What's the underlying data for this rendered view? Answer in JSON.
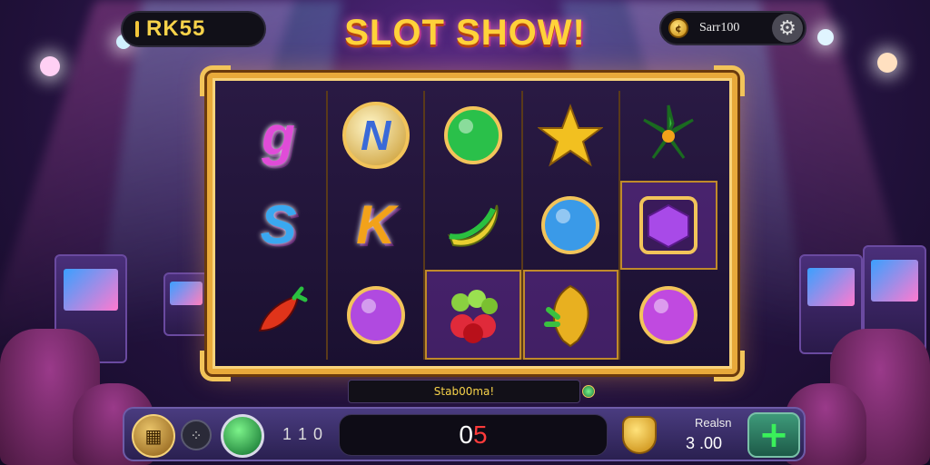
{
  "header": {
    "balance": "RK55",
    "title": "SLOT SHOW!",
    "settings_label": "Sarr100",
    "coin_icon": "coin-icon",
    "gear_icon": "gear-icon"
  },
  "reels": [
    [
      {
        "label": "g",
        "kind": "letter",
        "color": "#e04cd8",
        "icon": "letter-g-icon"
      },
      {
        "label": "S",
        "kind": "letter",
        "color": "#3aa8f0",
        "icon": "letter-s-icon"
      },
      {
        "label": "",
        "kind": "chili",
        "color": "#e0341a",
        "icon": "chili-pepper-icon"
      }
    ],
    [
      {
        "label": "N",
        "kind": "badge",
        "color": "#3a6ad8",
        "icon": "letter-n-coin-icon"
      },
      {
        "label": "K",
        "kind": "letter",
        "color": "#f2a21a",
        "icon": "letter-k-icon"
      },
      {
        "label": "",
        "kind": "gem",
        "color": "#b04ae0",
        "icon": "purple-gem-icon"
      }
    ],
    [
      {
        "label": "",
        "kind": "gem",
        "color": "#2ac04a",
        "icon": "green-gem-icon"
      },
      {
        "label": "",
        "kind": "banana",
        "color": "#e8d030",
        "icon": "banana-icon"
      },
      {
        "label": "",
        "kind": "cherries",
        "color": "#e02a3a",
        "icon": "cherries-icon",
        "highlight": true
      }
    ],
    [
      {
        "label": "",
        "kind": "star",
        "color": "#f2c020",
        "icon": "star-icon"
      },
      {
        "label": "",
        "kind": "gem",
        "color": "#3a9ae8",
        "icon": "blue-gem-icon"
      },
      {
        "label": "",
        "kind": "shield",
        "color": "#e8b020",
        "icon": "gold-leaf-icon",
        "highlight": true
      }
    ],
    [
      {
        "label": "",
        "kind": "leaf",
        "color": "#3ac040",
        "icon": "leaf-icon"
      },
      {
        "label": "",
        "kind": "cube",
        "color": "#a84ae8",
        "icon": "purple-cube-icon",
        "highlight": true
      },
      {
        "label": "",
        "kind": "gem",
        "color": "#c04ae0",
        "icon": "violet-gem-icon"
      }
    ]
  ],
  "info_strip": "Stab00ma!",
  "bottom": {
    "line_count": "1 1 0",
    "win_main": "0",
    "win_accent": "5",
    "reg_label": "Realsn",
    "reg_value": "3 .00",
    "plus_symbol": "+"
  }
}
